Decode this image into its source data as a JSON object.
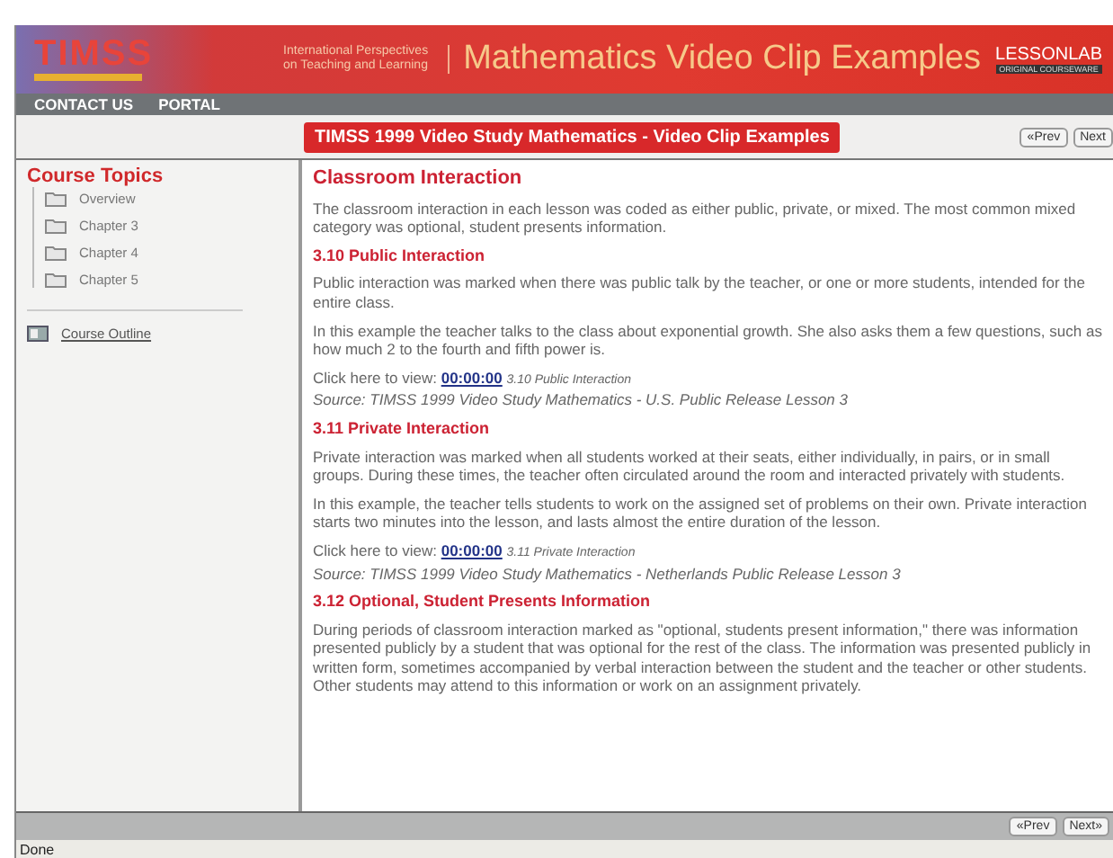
{
  "header": {
    "logo": "TIMSS",
    "tagline": "International Perspectives on Teaching and Learning",
    "title": "Mathematics Video Clip Examples",
    "brand": "LESSONLAB",
    "brand_sub": "ORIGINAL COURSEWARE"
  },
  "nav": [
    "CONTACT US",
    "PORTAL"
  ],
  "banner": "TIMSS 1999 Video Study Mathematics - Video Clip Examples",
  "pager_top": [
    "«Prev",
    "Next"
  ],
  "sidebar": {
    "heading": "Course Topics",
    "items": [
      {
        "label": "Overview",
        "kind": "folder"
      },
      {
        "label": "Chapter 3",
        "kind": "folder"
      },
      {
        "label": "Chapter 4",
        "kind": "folder"
      },
      {
        "label": "Chapter 5",
        "kind": "folder"
      },
      {
        "label": "Course Outline",
        "kind": "outline"
      }
    ]
  },
  "content": [
    {
      "kind": "title",
      "text": "Classroom Interaction"
    },
    {
      "kind": "para",
      "text": "The classroom interaction in each lesson was coded as either public, private, or mixed. The most common mixed category was optional, student presents information."
    },
    {
      "kind": "heading",
      "text": "3.10 Public Interaction"
    },
    {
      "kind": "para",
      "text": "Public interaction was marked when there was public talk by the teacher, or one or more students, intended for the entire class."
    },
    {
      "kind": "para",
      "text": "In this example the teacher talks to the class about exponential growth. She also asks them a few questions, such as how much 2 to the fourth and fifth power is."
    },
    {
      "kind": "clip",
      "prefix": "Click here to view:",
      "time": "00:00:00",
      "caption": "3.10 Public Interaction",
      "source": "Source: TIMSS 1999 Video Study Mathematics - U.S. Public Release Lesson 3"
    },
    {
      "kind": "heading",
      "text": "3.11 Private Interaction"
    },
    {
      "kind": "para",
      "text": "Private interaction was marked when all students worked at their seats, either individually, in pairs, or in small groups. During these times, the teacher often circulated around the room and interacted privately with students."
    },
    {
      "kind": "para",
      "text": "In this example, the teacher tells students to work on the assigned set of problems on their own. Private interaction starts two minutes into the lesson, and lasts almost the entire duration of the lesson."
    },
    {
      "kind": "clip",
      "prefix": "Click here to view:",
      "time": "00:00:00",
      "caption": "3.11 Private Interaction",
      "source": "Source: TIMSS 1999 Video Study Mathematics - Netherlands Public Release Lesson 3"
    },
    {
      "kind": "heading",
      "text": "3.12 Optional, Student Presents Information"
    },
    {
      "kind": "para",
      "text": "During periods of classroom interaction marked as \"optional, students present information,\" there was information presented publicly by a student that was optional for the rest of the class. The information was presented publicly in written form, sometimes accompanied by verbal interaction between the student and the teacher or other students. Other students may attend to this information or work on an assignment privately."
    }
  ],
  "pager_bottom": [
    "«Prev",
    "Next»"
  ],
  "status": "Done"
}
